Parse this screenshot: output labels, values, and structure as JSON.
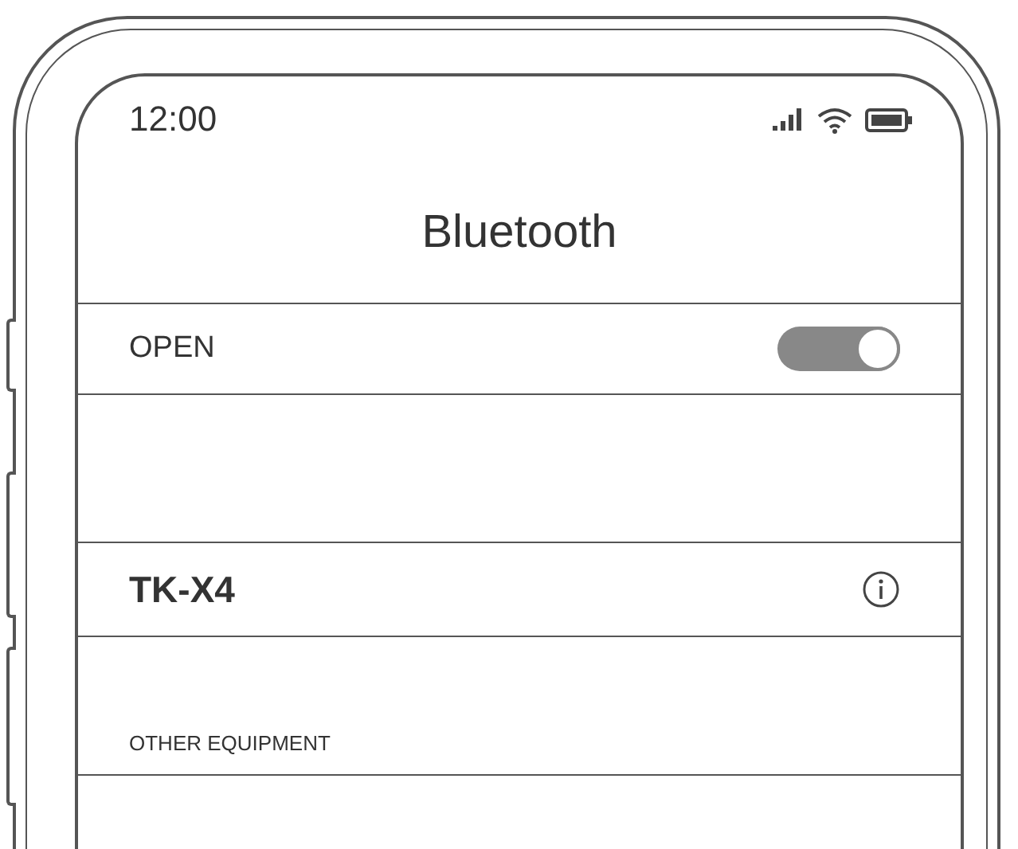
{
  "status_bar": {
    "time": "12:00"
  },
  "title": "Bluetooth",
  "bluetooth_toggle": {
    "label": "OPEN",
    "on": true
  },
  "devices": [
    {
      "name": "TK-X4"
    }
  ],
  "section_label": "OTHER EQUIPMENT"
}
